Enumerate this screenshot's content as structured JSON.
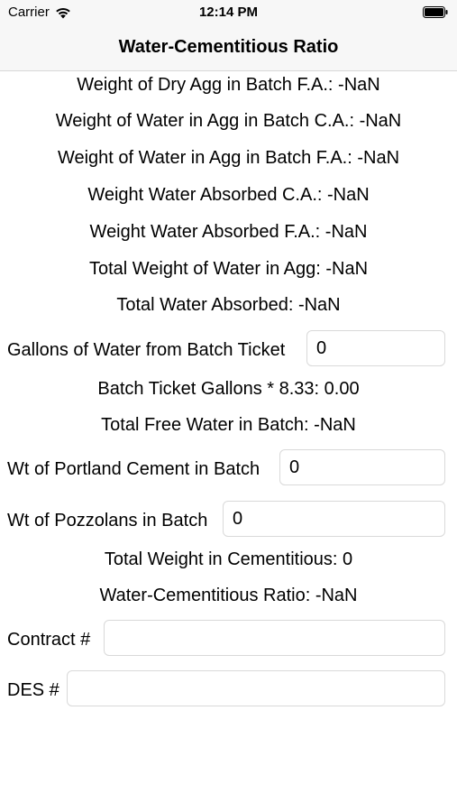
{
  "status_bar": {
    "carrier": "Carrier",
    "time": "12:14 PM"
  },
  "nav": {
    "title": "Water-Cementitious Ratio"
  },
  "results": {
    "dry_agg_fa": "Weight of Dry Agg in Batch F.A.: -NaN",
    "water_agg_ca": "Weight of Water in Agg in Batch C.A.: -NaN",
    "water_agg_fa": "Weight of Water in Agg in Batch F.A.: -NaN",
    "absorbed_ca": "Weight Water Absorbed C.A.: -NaN",
    "absorbed_fa": "Weight Water Absorbed F.A.: -NaN",
    "total_water_agg": "Total Weight of Water in Agg: -NaN",
    "total_absorbed": "Total Water Absorbed: -NaN",
    "batch_ticket_gallons": "Batch Ticket Gallons * 8.33: 0.00",
    "total_free_water": "Total Free Water in Batch: -NaN",
    "total_cementitious": "Total Weight in Cementitious: 0",
    "wc_ratio": "Water-Cementitious Ratio: -NaN"
  },
  "fields": {
    "gallons": {
      "label": "Gallons of Water from Batch Ticket",
      "value": "0"
    },
    "portland": {
      "label": "Wt of Portland Cement in Batch",
      "value": "0"
    },
    "pozzolans": {
      "label": "Wt of Pozzolans in Batch",
      "value": "0"
    },
    "contract": {
      "label": "Contract #",
      "value": ""
    },
    "des": {
      "label": "DES #",
      "value": ""
    }
  }
}
